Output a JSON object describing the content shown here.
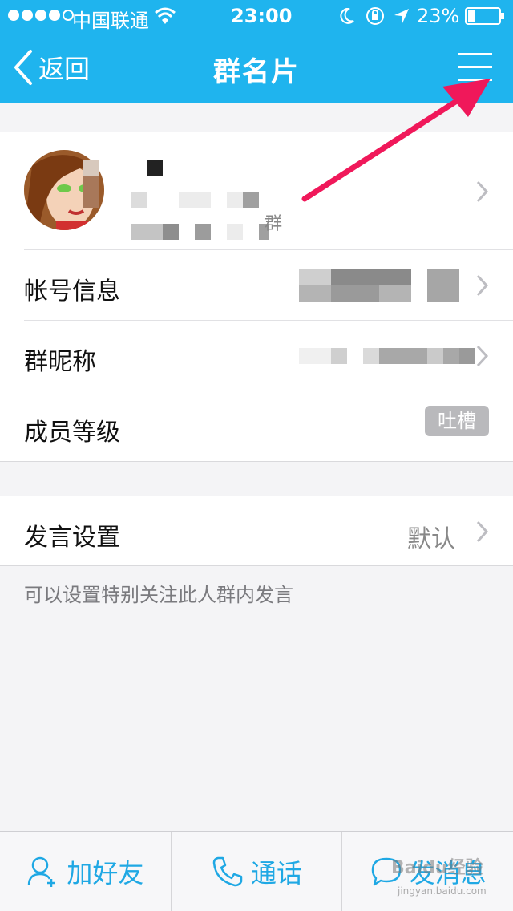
{
  "status_bar": {
    "carrier": "中国联通",
    "time": "23:00",
    "battery": "23%"
  },
  "nav": {
    "back_label": "返回",
    "title": "群名片"
  },
  "profile": {
    "name_fragment": "群"
  },
  "rows": [
    {
      "label": "帐号信息"
    },
    {
      "label": "群昵称"
    },
    {
      "label": "成员等级",
      "badge": "吐槽"
    }
  ],
  "speak_settings": {
    "label": "发言设置",
    "value": "默认",
    "hint": "可以设置特别关注此人群内发言"
  },
  "toolbar": {
    "add_friend": "加好友",
    "call": "通话",
    "message": "发消息"
  },
  "watermark": {
    "logo": "Baidu经验",
    "url": "jingyan.baidu.com"
  },
  "colors": {
    "accent": "#1fb4ee",
    "toolbar_text": "#1fa8e4",
    "arrow": "#f0185a"
  }
}
